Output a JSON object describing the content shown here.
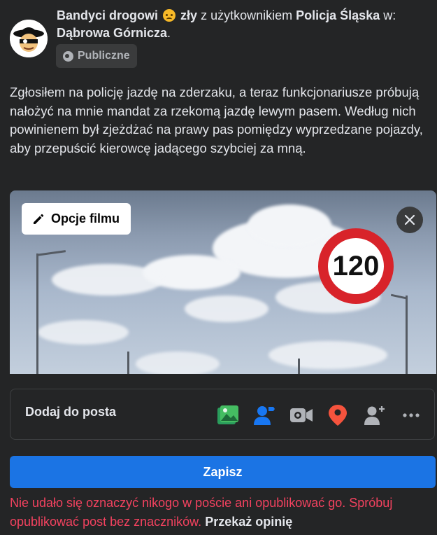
{
  "header": {
    "author": "Bandyci drogowi",
    "feeling_icon": "angry-emoji-icon",
    "feeling": "zły",
    "with_text": "z użytkownikiem",
    "tagged_user": "Policja Śląska",
    "in_text": "w:",
    "location": "Dąbrowa Górnicza",
    "period": "."
  },
  "privacy": {
    "icon": "globe-icon",
    "label": "Publiczne"
  },
  "post": {
    "text": "Zgłosiłem na policję jazdę na zderzaku, a teraz funkcjonariusze próbują nałożyć na mnie mandat za rzekomą jazdę lewym pasem. Według nich powinienem był zjeżdżać na prawy pas pomiędzy wyprzedzane pojazdy, aby przepuścić kierowcę jadącego szybciej za mną."
  },
  "video": {
    "options_label": "Opcje filmu",
    "sign_text": "120",
    "close_icon": "close-icon"
  },
  "add_to_post": {
    "label": "Dodaj do posta",
    "tools": [
      "photo-video-icon",
      "tag-people-icon",
      "live-video-icon",
      "location-pin-icon",
      "add-person-icon",
      "more-icon"
    ]
  },
  "save_label": "Zapisz",
  "error": {
    "message": "Nie udało się oznaczyć nikogo w poście ani opublikować go. Spróbuj opublikować post bez znaczników.",
    "link": "Przekaż opinię"
  },
  "colors": {
    "accent": "#1b74e4",
    "error": "#f3425f",
    "background": "#242526"
  }
}
